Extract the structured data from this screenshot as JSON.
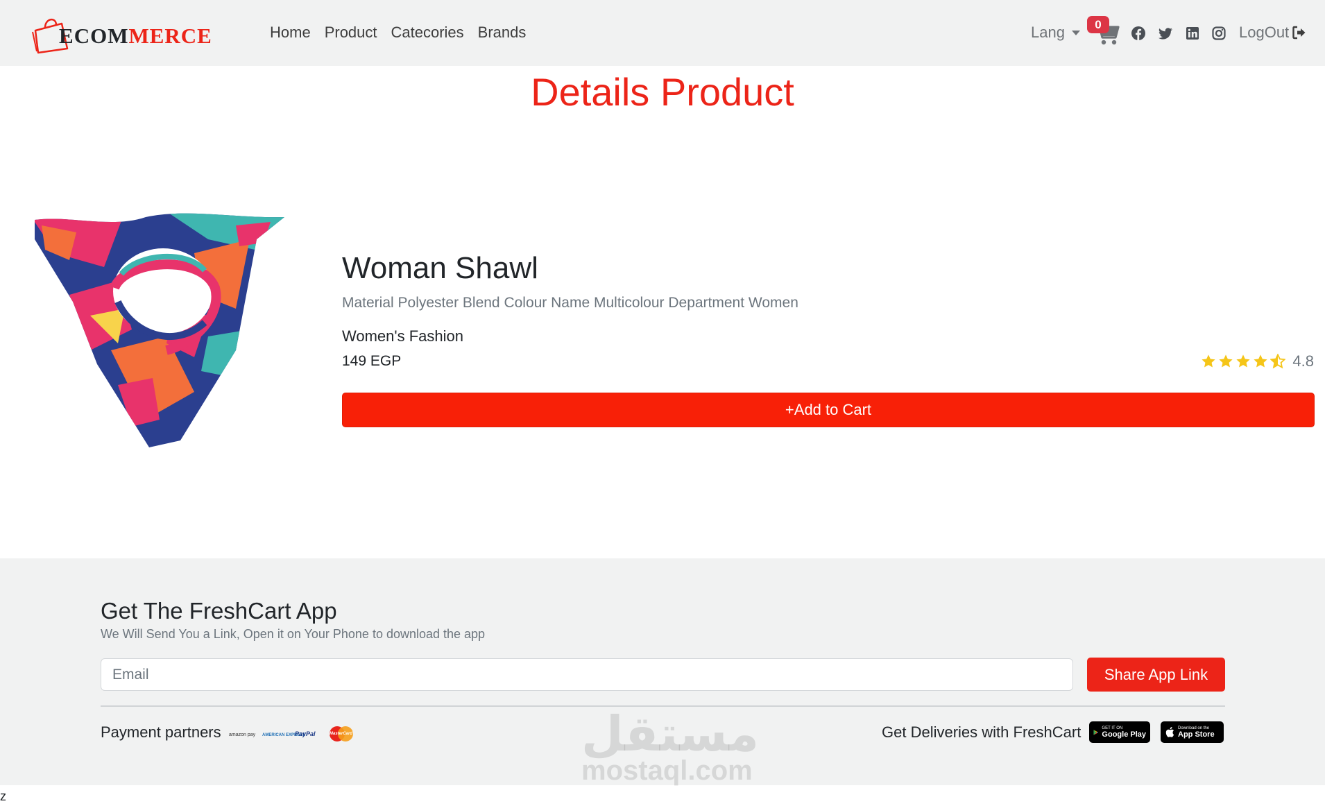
{
  "app": {
    "logo": {
      "prefix": "E",
      "part1": "COM",
      "part2": "MERCE"
    }
  },
  "nav": {
    "links": [
      "Home",
      "Product",
      "Catecories",
      "Brands"
    ],
    "lang_label": "Lang",
    "cart_count": "0",
    "social_icons": [
      "facebook-icon",
      "twitter-icon",
      "linkedin-icon",
      "instagram-icon"
    ],
    "logout_label": "LogOut"
  },
  "page": {
    "title": "Details Product"
  },
  "product": {
    "name": "Woman Shawl",
    "description": "Material Polyester Blend Colour Name Multicolour Department Women",
    "category": "Women's Fashion",
    "price": "149 EGP",
    "rating": 4.8,
    "rating_label": "4.8",
    "add_to_cart_label": "+Add to Cart"
  },
  "footer": {
    "title": "Get The FreshCart App",
    "subtitle": "We Will Send You a Link, Open it on Your Phone to download the app",
    "email_placeholder": "Email",
    "share_button": "Share App Link",
    "payment_label": "Payment partners",
    "payment_partners": [
      "amazon pay",
      "AMERICAN EXPRESS",
      "PayPal",
      "MasterCard"
    ],
    "deliveries_label": "Get Deliveries with FreshCart",
    "google_play": {
      "small": "GET IT ON",
      "big": "Google Play"
    },
    "app_store": {
      "small": "Download on the",
      "big": "App Store"
    }
  },
  "watermark": {
    "arabic": "مستقل",
    "latin": "mostaql.com"
  },
  "stray_text": "z",
  "colors": {
    "accent": "#ec2418",
    "button": "#f82007",
    "badge": "#dc3545",
    "star": "#f5c518",
    "background_light": "#f1f2f2"
  }
}
